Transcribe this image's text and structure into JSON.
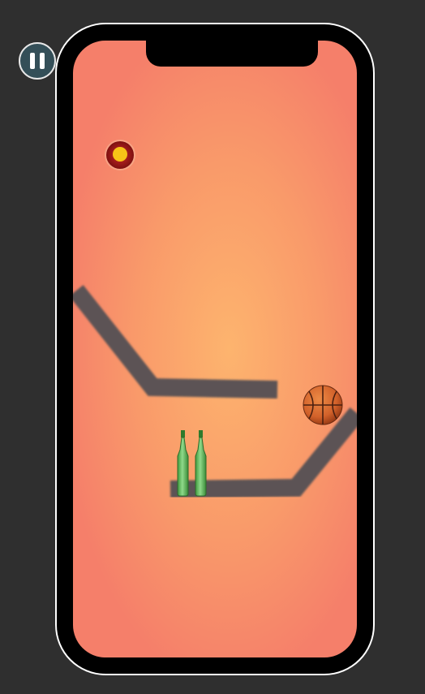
{
  "app": {
    "name": "bottle-ball-physics-game"
  },
  "controls": {
    "pause_icon": "pause-icon"
  },
  "colors": {
    "background": "#2f2f2f",
    "phone_frame": "#000000",
    "screen_center": "#fdb46e",
    "screen_edge": "#f57f6a",
    "platform": "#5b5354",
    "pause_button": "#344f58",
    "target_outer": "#b01d1d",
    "target_inner": "#f7c417",
    "ball": "#d2612a",
    "bottle": "#5fbf59"
  },
  "level": {
    "bottles_count": 2
  }
}
